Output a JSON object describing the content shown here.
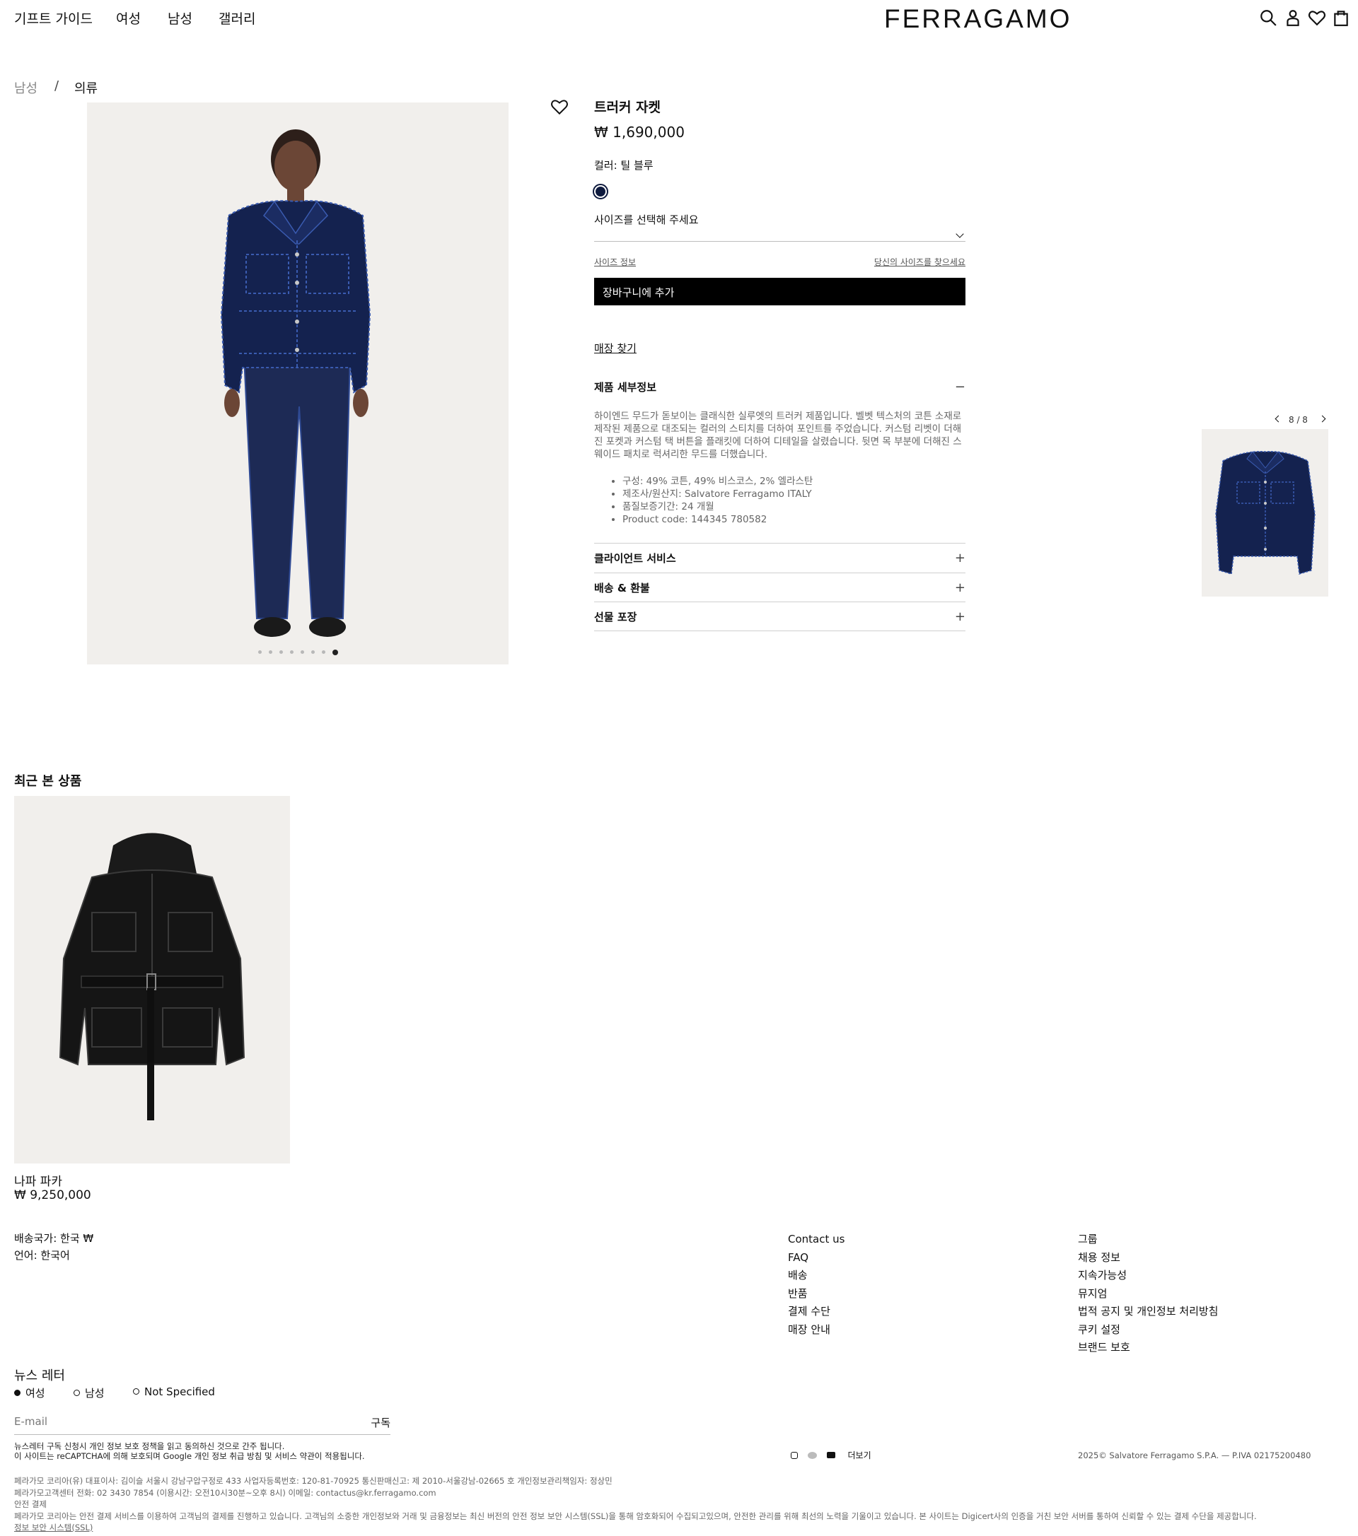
{
  "header": {
    "nav": [
      "기프트 가이드",
      "여성",
      "남성",
      "갤러리"
    ],
    "logo": "FERRAGAMO",
    "icons": [
      "search-icon",
      "account-icon",
      "wishlist-icon",
      "bag-icon"
    ]
  },
  "breadcrumb": {
    "items": [
      "남성",
      "의류"
    ],
    "separator": "/"
  },
  "product": {
    "title": "트러커 자켓",
    "price": "₩ 1,690,000",
    "color_label": "컬러: 틸 블루",
    "swatch_color": "#0e1a3e",
    "size_placeholder": "사이즈를 선택해 주세요",
    "size_info": "사이즈 정보",
    "find_size": "당신의 사이즈를 찾으세요",
    "add_to_cart": "장바구니에 추가",
    "store_locator": "매장 찾기",
    "details_title": "제품 세부정보",
    "details_sign": "−",
    "description": "하이엔드 무드가 돋보이는 클래식한 실루엣의 트러커 제품입니다. 벨벳 텍스처의 코튼 소재로 제작된 제품으로 대조되는 컬러의 스티치를 더하여 포인트를 주었습니다. 커스텀 리벳이 더해진 포켓과 커스텀 택 버튼을 플래킷에 더하여 디테일을 살렸습니다. 뒷면 목 부분에 더해진 스웨이드 패치로 럭셔리한 무드를 더했습니다.",
    "specs": [
      "구성: 49% 코튼, 49% 비스코스, 2% 엘라스탄",
      "제조사/원산지: Salvatore Ferragamo ITALY",
      "품질보증기간: 24 개월",
      "Product code: 144345 780582"
    ],
    "accordions": [
      {
        "label": "클라이언트 서비스",
        "sign": "+"
      },
      {
        "label": "배송 & 환불",
        "sign": "+"
      },
      {
        "label": "선물 포장",
        "sign": "+"
      }
    ]
  },
  "gallery": {
    "counter": "8 / 8",
    "total_dots": 8,
    "active_dot": 8
  },
  "recently_viewed": {
    "title": "최근 본 상품",
    "items": [
      {
        "name": "나파 파카",
        "price": "₩ 9,250,000"
      }
    ]
  },
  "footer": {
    "shipping_country": "배송국가: 한국 ₩",
    "language": "언어: 한국어",
    "service_links": [
      "Contact us",
      "FAQ",
      "배송",
      "반품",
      "결제 수단",
      "매장 안내"
    ],
    "corporate_links": [
      "그룹",
      "채용 정보",
      "지속가능성",
      "뮤지엄",
      "법적 공지 및 개인정보 처리방침",
      "쿠키 설정",
      "브랜드 보호"
    ],
    "newsletter": {
      "title": "뉴스 레터",
      "options": [
        "여성",
        "남성",
        "Not Specified"
      ],
      "selected": "여성",
      "email_placeholder": "E-mail",
      "subscribe": "구독"
    },
    "consent_line1": "뉴스레터 구독 신청시 개인 정보 보호 정책을 읽고 동의하신 것으로 간주 됩니다.",
    "consent_line2": "이 사이트는 reCAPTCHA에 의해 보호되며 Google 개인 정보 취급 방침 및 서비스 약관이 적용됩니다.",
    "social_more": "더보기",
    "copyright": "2025© Salvatore Ferragamo S.P.A. — P.IVA 02175200480",
    "corp_info": [
      "페라가모 코리아(유) 대표이사: 김이슬 서울시 강남구압구정로 433 사업자등록번호: 120-81-70925 통신판매신고: 제 2010-서울강남-02665 호 개인정보관리책임자: 정상민",
      "페라가모고객센터 전화: 02 3430 7854 (이용시간: 오전10시30분~오후 8시) 이메일: contactus@kr.ferragamo.com",
      "안전 결제",
      "페라가모 코리아는 안전 결제 서비스를 이용하여 고객님의 결제를 진행하고 있습니다. 고객님의 소중한 개인정보와 거래 및 금융정보는 최신 버전의 안전 정보 보안 시스템(SSL)을 통해 암호화되어 수집되고있으며, 안전한 관리를 위해 최선의 노력을 기울이고 있습니다. 본 사이트는 Digicert사의 인증을 거친 보안 서버를 통하여 신뢰할 수 있는 결제 수단을 제공합니다.",
      "정보 보안 시스템(SSL)"
    ]
  }
}
